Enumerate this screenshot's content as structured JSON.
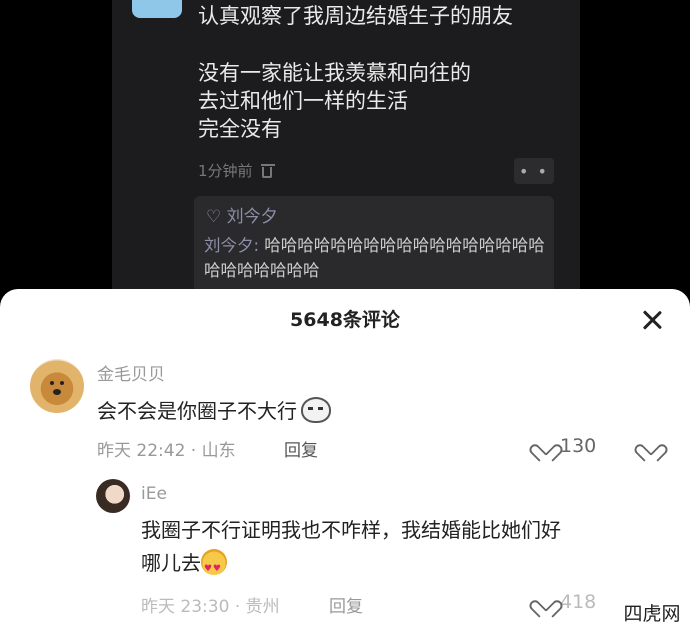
{
  "post": {
    "lines": [
      "认真观察了我周边结婚生子的朋友",
      "没有一家能让我羡慕和向往的",
      "去过和他们一样的生活",
      "完全没有"
    ],
    "time": "1分钟前",
    "more_label": "• •",
    "reply_box": {
      "liked_by": "♡ 刘今夕",
      "reply_name": "刘今夕:",
      "reply_text": " 哈哈哈哈哈哈哈哈哈哈哈哈哈哈哈哈哈哈哈哈哈哈哈哈"
    }
  },
  "sheet": {
    "title": "5648条评论",
    "comments": [
      {
        "user": "金毛贝贝",
        "text": "会不会是你圈子不大行",
        "meta": "昨天 22:42 · 山东",
        "reply_label": "回复",
        "likes": "130"
      },
      {
        "user": "iEe",
        "text_line1": "我圈子不行证明我也不咋样，我结婚能比她们好",
        "text_line2": "哪儿去",
        "meta": "昨天 23:30 · 贵州",
        "reply_label": "回复",
        "likes": "418"
      }
    ]
  },
  "watermark": "四虎网"
}
